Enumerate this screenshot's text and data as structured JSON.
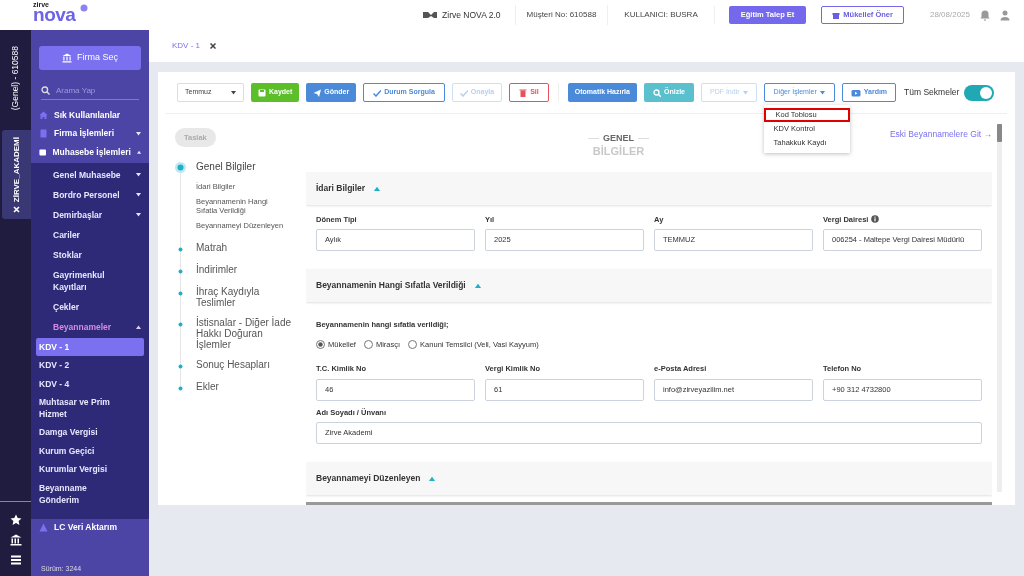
{
  "logo": {
    "small": "zirve",
    "big": "nova"
  },
  "header": {
    "product": "Zirve NOVA 2.0",
    "customer": "Müşteri No: 610588",
    "user": "KULLANICI: BUSRA",
    "buttons": [
      {
        "label": "Eğitim Talep Et",
        "kind": "filled"
      },
      {
        "label": "Mükellef Öner",
        "kind": "outline"
      }
    ],
    "date": "28/08/2025"
  },
  "rail": {
    "account": "(Genel) - 610588",
    "company_tab": "ZİRVE_AKADEMİ"
  },
  "sidebar": {
    "select_button": "Firma Seç",
    "search": {
      "placeholder": "Arama Yap"
    },
    "items": [
      {
        "label": "Sık Kullanılanlar",
        "kind": "link",
        "selected": false
      },
      {
        "label": "Firma İşlemleri",
        "kind": "group",
        "expanded": false,
        "selected": false
      },
      {
        "label": "Muhasebe İşlemleri",
        "kind": "group",
        "expanded": true,
        "selected": false,
        "children": [
          {
            "label": "Genel Muhasebe",
            "kind": "group",
            "expanded": false,
            "selected": false
          },
          {
            "label": "Bordro Personel",
            "kind": "group",
            "expanded": false,
            "selected": false
          },
          {
            "label": "Demirbaşlar",
            "kind": "group",
            "expanded": false,
            "selected": false
          },
          {
            "label": "Cariler",
            "kind": "link",
            "selected": false
          },
          {
            "label": "Stoklar",
            "kind": "link",
            "selected": false
          },
          {
            "label": "Gayrimenkul Kayıtları",
            "kind": "link",
            "selected": false
          },
          {
            "label": "Çekler",
            "kind": "link",
            "selected": false
          },
          {
            "label": "Beyannameler",
            "kind": "group",
            "expanded": true,
            "selected": false,
            "children": [
              {
                "label": "KDV - 1",
                "kind": "link",
                "selected": true
              },
              {
                "label": "KDV - 2",
                "kind": "link",
                "selected": false
              },
              {
                "label": "KDV - 4",
                "kind": "link",
                "selected": false
              },
              {
                "label": "Muhtasar ve Prim Hizmet",
                "kind": "link",
                "selected": false
              },
              {
                "label": "Damga Vergisi",
                "kind": "link",
                "selected": false
              },
              {
                "label": "Kurum Geçici",
                "kind": "link",
                "selected": false
              },
              {
                "label": "Kurumlar Vergisi",
                "kind": "link",
                "selected": false
              },
              {
                "label": "Beyanname Gönderim",
                "kind": "link",
                "selected": false
              }
            ]
          }
        ]
      },
      {
        "label": "LC Veri Aktarım",
        "kind": "link",
        "selected": false
      }
    ],
    "version": "Sürüm: 3244"
  },
  "tabs": [
    {
      "label": "KDV - 1",
      "selected": true
    }
  ],
  "toolbar": {
    "buttons": [
      {
        "label": "Temmuz",
        "kind": "select",
        "disabled": false
      },
      {
        "label": "Kaydet",
        "kind": "success",
        "disabled": false
      },
      {
        "label": "Gönder",
        "kind": "primary",
        "disabled": false
      },
      {
        "label": "Durum Sorgula",
        "kind": "outline",
        "disabled": false
      },
      {
        "label": "Onayla",
        "kind": "outline",
        "disabled": true
      },
      {
        "label": "Sil",
        "kind": "danger",
        "disabled": false
      },
      {
        "label": "Otomatik Hazırla",
        "kind": "primary",
        "disabled": false
      },
      {
        "label": "Önizle",
        "kind": "info",
        "disabled": false
      },
      {
        "label": "PDF İndir",
        "kind": "dropdown",
        "disabled": true
      },
      {
        "label": "Diğer İşlemler",
        "kind": "dropdown",
        "disabled": false,
        "expanded": true,
        "menu": [
          {
            "label": "Kod Toblosu",
            "highlighted": true
          },
          {
            "label": "KDV Kontrol",
            "highlighted": false
          },
          {
            "label": "Tahakkuk Kaydı",
            "highlighted": false
          }
        ]
      },
      {
        "label": "Yardım",
        "kind": "video",
        "disabled": false
      }
    ],
    "toggle": {
      "label": "Tüm Sekmeler",
      "on": true
    }
  },
  "status_badge": "Taslak",
  "steps": [
    {
      "label": "Genel Bilgiler",
      "selected": true,
      "children": [
        {
          "label": "İdari Bilgiler"
        },
        {
          "label": "Beyannamenin Hangi Sıfatla Verildiği"
        },
        {
          "label": "Beyannameyi Düzenleyen"
        }
      ]
    },
    {
      "label": "Matrah",
      "selected": false
    },
    {
      "label": "İndirimler",
      "selected": false
    },
    {
      "label": "İhraç Kaydıyla Teslimler",
      "selected": false
    },
    {
      "label": "İstisnalar - Diğer İade Hakkı Doğuran İşlemler",
      "selected": false
    },
    {
      "label": "Sonuç Hesapları",
      "selected": false
    },
    {
      "label": "Ekler",
      "selected": false
    }
  ],
  "heading": {
    "line_1": "GENEL",
    "line_2": "BİLGİLER"
  },
  "old_returns_link": "Eski Beyannamelere Git →",
  "sections": [
    {
      "title": "İdari Bilgiler",
      "expanded": true,
      "rows": [
        [
          {
            "label": "Dönem Tipi",
            "value": "Aylık",
            "info": false
          },
          {
            "label": "Yıl",
            "value": "2025",
            "info": false
          },
          {
            "label": "Ay",
            "value": "TEMMUZ",
            "info": false
          },
          {
            "label": "Vergi Dairesi",
            "value": "006254 - Maltepe Vergi Dairesi Müdürlü",
            "info": true
          }
        ]
      ]
    },
    {
      "title": "Beyannamenin Hangi Sıfatla Verildiği",
      "expanded": true,
      "question": "Beyannamenin hangi sıfatla verildiği;",
      "options": [
        {
          "label": "Mükellef",
          "selected": true
        },
        {
          "label": "Mirasçı",
          "selected": false
        },
        {
          "label": "Kanuni Temsilci (Veli, Vasi Kayyum)",
          "selected": false
        }
      ],
      "rows": [
        [
          {
            "label": "T.C. Kimlik No",
            "value": "46",
            "info": false
          },
          {
            "label": "Vergi Kimlik No",
            "value": "61",
            "info": false
          },
          {
            "label": "e-Posta Adresi",
            "value": "info@zirveyazilim.net",
            "info": false
          },
          {
            "label": "Telefon No",
            "value": "+90 312 4732800",
            "info": false
          }
        ],
        [
          {
            "label": "Adı Soyadı / Ünvanı",
            "value": "Zirve Akademi",
            "info": false
          }
        ]
      ]
    },
    {
      "title": "Beyannameyi Düzenleyen",
      "expanded": true
    }
  ]
}
